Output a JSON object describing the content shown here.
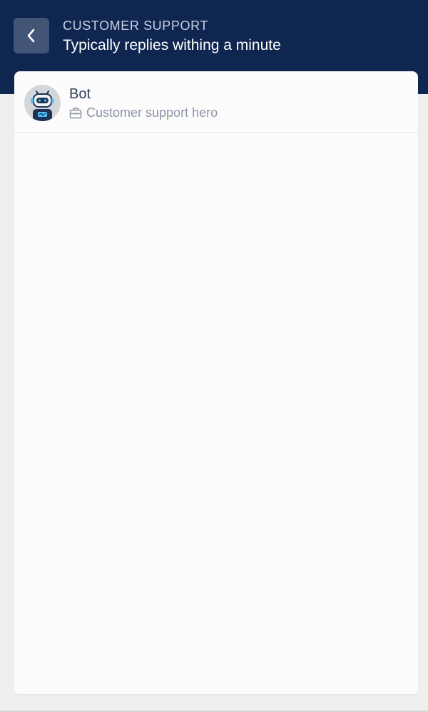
{
  "header": {
    "eyebrow": "CUSTOMER SUPPORT",
    "title": "Typically replies withing a minute",
    "background_color": "#0f2650",
    "back_icon": "chevron-left-icon"
  },
  "agent": {
    "name": "Bot",
    "role": "Customer support hero",
    "avatar_icon": "robot-icon",
    "role_icon": "briefcase-icon"
  }
}
